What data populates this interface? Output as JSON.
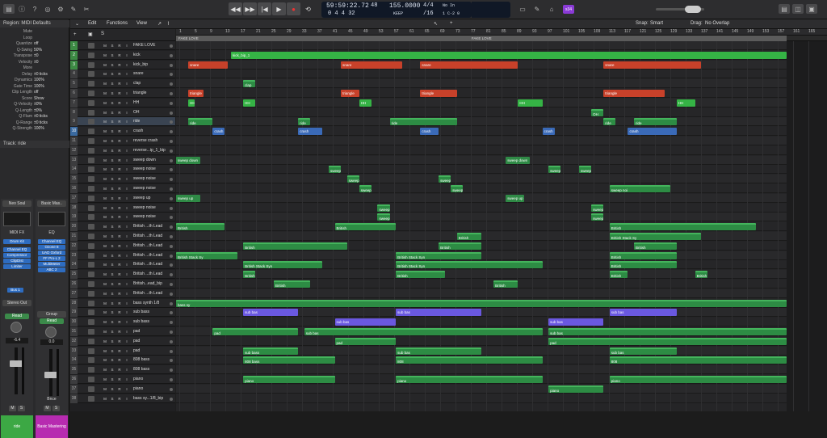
{
  "lcd": {
    "time": "59:59:22.72",
    "bars": "0  4  4    32",
    "tempo_top": "48",
    "tempo": "155.0000",
    "keep": "KEEP",
    "sig": "4/4",
    "div": "/16",
    "in": "No In",
    "out": "1 C-2 0"
  },
  "toolbar": {
    "mode_badge": "s34"
  },
  "menus": {
    "edit": "Edit",
    "functions": "Functions",
    "view": "View",
    "snap_label": "Snap:",
    "snap_value": "Smart",
    "drag_label": "Drag:",
    "drag_value": "No Overlap"
  },
  "inspector": {
    "region_title": "Region: MIDI Defaults",
    "params": [
      {
        "k": "Mute",
        "v": ""
      },
      {
        "k": "Loop",
        "v": ""
      },
      {
        "k": "Quantize",
        "v": "off"
      },
      {
        "k": "Q-Swing",
        "v": "50%"
      },
      {
        "k": "Transpose",
        "v": "±0"
      },
      {
        "k": "Velocity",
        "v": "±0"
      },
      {
        "k": "More",
        "v": ""
      },
      {
        "k": "Delay",
        "v": "±0 ticks"
      },
      {
        "k": "Dynamics",
        "v": "100%"
      },
      {
        "k": "Gate Time",
        "v": "100%"
      },
      {
        "k": "Clip Length",
        "v": "off"
      },
      {
        "k": "Score",
        "v": "Show"
      },
      {
        "k": "Q-Velocity",
        "v": "±0%"
      },
      {
        "k": "Q-Length",
        "v": "±0%"
      },
      {
        "k": "Q-Flam",
        "v": "±0 ticks"
      },
      {
        "k": "Q-Range",
        "v": "±0 ticks"
      },
      {
        "k": "Q-Strength",
        "v": "100%"
      }
    ],
    "track_title": "Track: ride",
    "strip1": {
      "name": "Neo Soul",
      "eqlabel": "MIDI FX",
      "inst": "Drum Kit",
      "plugins": [
        "Channel EQ",
        "Compressor",
        "ClipDist",
        "Limiter"
      ],
      "bus": "Bus 1",
      "out": "Stereo Out",
      "read": "Read",
      "db": "-6.4",
      "foot": "ride"
    },
    "strip2": {
      "name": "Basic Mas..",
      "eqlabel": "EQ",
      "plugins": [
        "Channel EQ",
        "Ozone 8",
        "UAD Oxford",
        "FF Pro-L 2",
        "MultiMeter",
        "ABC 2"
      ],
      "out": "Group",
      "read": "Read",
      "db": "0.0",
      "bnce": "Bnce",
      "foot": "Basic Mastering"
    }
  },
  "tracks": [
    {
      "n": "1",
      "name": "FAKE LOVE",
      "c": "g"
    },
    {
      "n": "2",
      "name": "kick",
      "c": "g"
    },
    {
      "n": "3",
      "name": "kick_bip",
      "c": "g"
    },
    {
      "n": "4",
      "name": "snare",
      "c": ""
    },
    {
      "n": "5",
      "name": "clap",
      "c": ""
    },
    {
      "n": "6",
      "name": "triangle",
      "c": ""
    },
    {
      "n": "7",
      "name": "HH",
      "c": ""
    },
    {
      "n": "8",
      "name": "OH",
      "c": ""
    },
    {
      "n": "9",
      "name": "ride",
      "c": "",
      "sel": true
    },
    {
      "n": "10",
      "name": "crash",
      "c": "b"
    },
    {
      "n": "11",
      "name": "reverse crash",
      "c": ""
    },
    {
      "n": "12",
      "name": "reverse...ip_1_bip",
      "c": ""
    },
    {
      "n": "13",
      "name": "sweep down",
      "c": ""
    },
    {
      "n": "14",
      "name": "sweep noise",
      "c": ""
    },
    {
      "n": "15",
      "name": "sweep noise",
      "c": ""
    },
    {
      "n": "16",
      "name": "sweep noise",
      "c": ""
    },
    {
      "n": "17",
      "name": "sweep up",
      "c": ""
    },
    {
      "n": "18",
      "name": "sweep noise",
      "c": ""
    },
    {
      "n": "19",
      "name": "sweep noise",
      "c": ""
    },
    {
      "n": "20",
      "name": "British ...th Lead",
      "c": ""
    },
    {
      "n": "21",
      "name": "British ...th Lead",
      "c": ""
    },
    {
      "n": "22",
      "name": "British ...th Lead",
      "c": ""
    },
    {
      "n": "23",
      "name": "British ...th Lead",
      "c": ""
    },
    {
      "n": "24",
      "name": "British ...th Lead",
      "c": ""
    },
    {
      "n": "25",
      "name": "British ...th Lead",
      "c": ""
    },
    {
      "n": "26",
      "name": "British...ead_bip",
      "c": ""
    },
    {
      "n": "27",
      "name": "British ...th Lead",
      "c": ""
    },
    {
      "n": "28",
      "name": "bass synth 1/8",
      "c": ""
    },
    {
      "n": "29",
      "name": "sub bass",
      "c": ""
    },
    {
      "n": "30",
      "name": "sub bass",
      "c": ""
    },
    {
      "n": "31",
      "name": "pad",
      "c": ""
    },
    {
      "n": "32",
      "name": "pad",
      "c": ""
    },
    {
      "n": "33",
      "name": "pad",
      "c": ""
    },
    {
      "n": "34",
      "name": "808 bass",
      "c": ""
    },
    {
      "n": "35",
      "name": "808 bass",
      "c": ""
    },
    {
      "n": "36",
      "name": "piano",
      "c": ""
    },
    {
      "n": "37",
      "name": "piano",
      "c": ""
    },
    {
      "n": "38",
      "name": "bass sy...1/8_bip",
      "c": ""
    }
  ],
  "ruler": [
    "1",
    "5",
    "9",
    "13",
    "17",
    "21",
    "25",
    "29",
    "33",
    "37",
    "41",
    "45",
    "49",
    "53",
    "57",
    "61",
    "65",
    "69",
    "73",
    "77",
    "81",
    "85",
    "89",
    "93",
    "97",
    "101",
    "105",
    "109",
    "113",
    "117",
    "121",
    "125",
    "129",
    "133",
    "137",
    "141",
    "145",
    "149",
    "153",
    "157",
    "161",
    "165"
  ],
  "markers": [
    {
      "label": "FAKE LOVE",
      "start": 0,
      "end": 48
    },
    {
      "label": "FAKE LOVE",
      "start": 48,
      "end": 100
    }
  ],
  "regions": [
    {
      "t": 1,
      "s": 9,
      "e": 100,
      "c": "bgreen",
      "l": "kick_bip_1"
    },
    {
      "t": 2,
      "s": 2,
      "e": 8.5,
      "c": "red",
      "l": "snare"
    },
    {
      "t": 2,
      "s": 27,
      "e": 37,
      "c": "red",
      "l": "snare"
    },
    {
      "t": 2,
      "s": 40,
      "e": 56,
      "c": "red",
      "l": "snare"
    },
    {
      "t": 2,
      "s": 70,
      "e": 86,
      "c": "red",
      "l": "snare"
    },
    {
      "t": 4,
      "s": 11,
      "e": 13,
      "c": "green",
      "l": "clap"
    },
    {
      "t": 5,
      "s": 2,
      "e": 4.5,
      "c": "red",
      "l": "triangle"
    },
    {
      "t": 5,
      "s": 27,
      "e": 30,
      "c": "red",
      "l": "triangle"
    },
    {
      "t": 5,
      "s": 40,
      "e": 46,
      "c": "red",
      "l": "triangle"
    },
    {
      "t": 5,
      "s": 70,
      "e": 80,
      "c": "red",
      "l": "triangle"
    },
    {
      "t": 6,
      "s": 2,
      "e": 3,
      "c": "bgreen",
      "l": "HH"
    },
    {
      "t": 6,
      "s": 11,
      "e": 13,
      "c": "bgreen",
      "l": "HH"
    },
    {
      "t": 6,
      "s": 30,
      "e": 32,
      "c": "bgreen",
      "l": "HH"
    },
    {
      "t": 6,
      "s": 56,
      "e": 60,
      "c": "bgreen",
      "l": "HH"
    },
    {
      "t": 6,
      "s": 82,
      "e": 85,
      "c": "bgreen",
      "l": "HH"
    },
    {
      "t": 7,
      "s": 68,
      "e": 70,
      "c": "green",
      "l": "OH"
    },
    {
      "t": 8,
      "s": 2,
      "e": 6,
      "c": "green",
      "l": "ride"
    },
    {
      "t": 8,
      "s": 20,
      "e": 22,
      "c": "green",
      "l": "ride"
    },
    {
      "t": 8,
      "s": 35,
      "e": 46,
      "c": "green",
      "l": "ride"
    },
    {
      "t": 8,
      "s": 70,
      "e": 72,
      "c": "green",
      "l": "ride"
    },
    {
      "t": 8,
      "s": 75,
      "e": 82,
      "c": "green",
      "l": "ride"
    },
    {
      "t": 9,
      "s": 6,
      "e": 8,
      "c": "blue",
      "l": "crash"
    },
    {
      "t": 9,
      "s": 20,
      "e": 24,
      "c": "blue",
      "l": "crash"
    },
    {
      "t": 9,
      "s": 40,
      "e": 43,
      "c": "blue",
      "l": "crash"
    },
    {
      "t": 9,
      "s": 60,
      "e": 62,
      "c": "blue",
      "l": "crash"
    },
    {
      "t": 9,
      "s": 74,
      "e": 82,
      "c": "blue",
      "l": "crash"
    },
    {
      "t": 12,
      "s": 0,
      "e": 4,
      "c": "mid",
      "l": "sweep down"
    },
    {
      "t": 12,
      "s": 54,
      "e": 58,
      "c": "mid",
      "l": "sweep down"
    },
    {
      "t": 13,
      "s": 25,
      "e": 27,
      "c": "green",
      "l": "sweep"
    },
    {
      "t": 13,
      "s": 61,
      "e": 63,
      "c": "green",
      "l": "sweep"
    },
    {
      "t": 13,
      "s": 66,
      "e": 68,
      "c": "green",
      "l": "sweep"
    },
    {
      "t": 14,
      "s": 28,
      "e": 30,
      "c": "green",
      "l": "sweep"
    },
    {
      "t": 14,
      "s": 43,
      "e": 45,
      "c": "green",
      "l": "sweep"
    },
    {
      "t": 15,
      "s": 30,
      "e": 32,
      "c": "green",
      "l": "sweep"
    },
    {
      "t": 15,
      "s": 45,
      "e": 47,
      "c": "green",
      "l": "sweep"
    },
    {
      "t": 15,
      "s": 71,
      "e": 81,
      "c": "green",
      "l": "sweep noi"
    },
    {
      "t": 16,
      "s": 0,
      "e": 4,
      "c": "mid",
      "l": "sweep up"
    },
    {
      "t": 16,
      "s": 54,
      "e": 57,
      "c": "mid",
      "l": "sweep up"
    },
    {
      "t": 17,
      "s": 33,
      "e": 35,
      "c": "green",
      "l": "sweep"
    },
    {
      "t": 17,
      "s": 68,
      "e": 70,
      "c": "green",
      "l": "sweep"
    },
    {
      "t": 18,
      "s": 33,
      "e": 35,
      "c": "green",
      "l": "sweep"
    },
    {
      "t": 18,
      "s": 68,
      "e": 70,
      "c": "green",
      "l": "sweep"
    },
    {
      "t": 19,
      "s": 0,
      "e": 8,
      "c": "green",
      "l": "British"
    },
    {
      "t": 19,
      "s": 26,
      "e": 36,
      "c": "green",
      "l": "British"
    },
    {
      "t": 19,
      "s": 71,
      "e": 95,
      "c": "green",
      "l": "British"
    },
    {
      "t": 20,
      "s": 46,
      "e": 50,
      "c": "green",
      "l": "British"
    },
    {
      "t": 20,
      "s": 71,
      "e": 86,
      "c": "green",
      "l": "British Stack Sy"
    },
    {
      "t": 21,
      "s": 11,
      "e": 28,
      "c": "green",
      "l": "British"
    },
    {
      "t": 21,
      "s": 43,
      "e": 50,
      "c": "green",
      "l": "British"
    },
    {
      "t": 21,
      "s": 75,
      "e": 82,
      "c": "green",
      "l": "British"
    },
    {
      "t": 22,
      "s": 0,
      "e": 10,
      "c": "green",
      "l": "British Stack Sy"
    },
    {
      "t": 22,
      "s": 36,
      "e": 50,
      "c": "green",
      "l": "British Stack Syn"
    },
    {
      "t": 22,
      "s": 71,
      "e": 82,
      "c": "green",
      "l": "British"
    },
    {
      "t": 23,
      "s": 11,
      "e": 24,
      "c": "green",
      "l": "British Stack Syn"
    },
    {
      "t": 23,
      "s": 36,
      "e": 60,
      "c": "green",
      "l": "British Stack Syn"
    },
    {
      "t": 23,
      "s": 71,
      "e": 82,
      "c": "green",
      "l": "British"
    },
    {
      "t": 24,
      "s": 11,
      "e": 13,
      "c": "green",
      "l": "British"
    },
    {
      "t": 24,
      "s": 36,
      "e": 44,
      "c": "green",
      "l": "British"
    },
    {
      "t": 24,
      "s": 71,
      "e": 74,
      "c": "green",
      "l": "British"
    },
    {
      "t": 24,
      "s": 85,
      "e": 87,
      "c": "green",
      "l": "British"
    },
    {
      "t": 25,
      "s": 16,
      "e": 22,
      "c": "green",
      "l": "British"
    },
    {
      "t": 25,
      "s": 52,
      "e": 56,
      "c": "green",
      "l": "British"
    },
    {
      "t": 27,
      "s": 0,
      "e": 100,
      "c": "green",
      "l": "bass sy"
    },
    {
      "t": 28,
      "s": 11,
      "e": 20,
      "c": "purple",
      "l": "sub bas"
    },
    {
      "t": 28,
      "s": 36,
      "e": 50,
      "c": "purple",
      "l": "sub bas"
    },
    {
      "t": 28,
      "s": 71,
      "e": 82,
      "c": "purple",
      "l": "sub bas"
    },
    {
      "t": 29,
      "s": 26,
      "e": 36,
      "c": "purple",
      "l": "sub bas"
    },
    {
      "t": 29,
      "s": 61,
      "e": 70,
      "c": "purple",
      "l": "sub bas"
    },
    {
      "t": 30,
      "s": 6,
      "e": 20,
      "c": "green",
      "l": "pad"
    },
    {
      "t": 30,
      "s": 21,
      "e": 60,
      "c": "green",
      "l": "sub bas"
    },
    {
      "t": 30,
      "s": 61,
      "e": 100,
      "c": "green",
      "l": "sub bas"
    },
    {
      "t": 31,
      "s": 26,
      "e": 36,
      "c": "green",
      "l": "pad"
    },
    {
      "t": 31,
      "s": 61,
      "e": 100,
      "c": "green",
      "l": "pad"
    },
    {
      "t": 32,
      "s": 11,
      "e": 20,
      "c": "green",
      "l": "sub bass"
    },
    {
      "t": 32,
      "s": 36,
      "e": 50,
      "c": "green",
      "l": "sub bas"
    },
    {
      "t": 32,
      "s": 71,
      "e": 82,
      "c": "green",
      "l": "sub bas"
    },
    {
      "t": 33,
      "s": 11,
      "e": 26,
      "c": "green",
      "l": "808 bass"
    },
    {
      "t": 33,
      "s": 36,
      "e": 60,
      "c": "green",
      "l": "808"
    },
    {
      "t": 33,
      "s": 71,
      "e": 100,
      "c": "green",
      "l": "808"
    },
    {
      "t": 35,
      "s": 11,
      "e": 26,
      "c": "green",
      "l": "piano"
    },
    {
      "t": 35,
      "s": 36,
      "e": 60,
      "c": "green",
      "l": "piano"
    },
    {
      "t": 35,
      "s": 71,
      "e": 100,
      "c": "green",
      "l": "piano"
    },
    {
      "t": 36,
      "s": 61,
      "e": 70,
      "c": "green",
      "l": "piano"
    }
  ],
  "colors": {
    "green": "#2d8c44",
    "red": "#c8412a",
    "blue": "#3a6ab8",
    "purple": "#6a58e0"
  }
}
